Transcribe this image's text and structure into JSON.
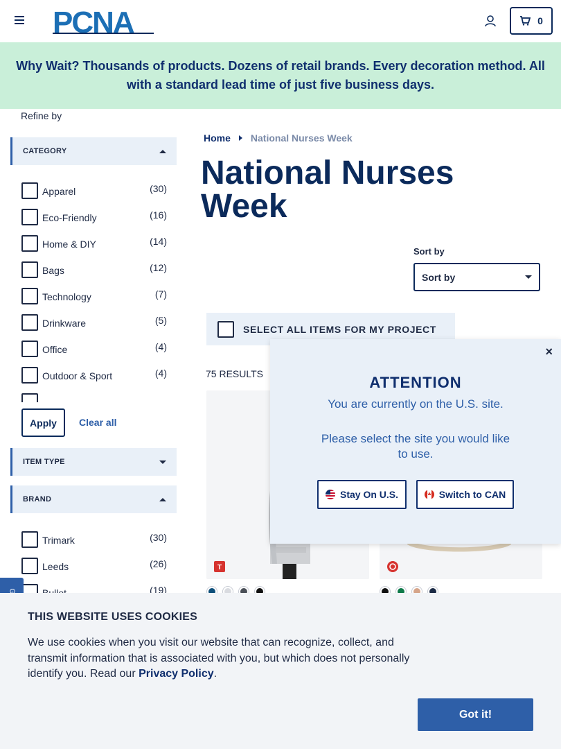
{
  "header": {
    "logo_text": "PCNA",
    "cart_count": "0"
  },
  "banner": {
    "text": "Why Wait? Thousands of products. Dozens of retail brands. Every decoration method. All with a standard lead time of just five business days."
  },
  "sidebar": {
    "refine_label": "Refine by",
    "category": {
      "title": "CATEGORY",
      "items": [
        {
          "label": "Apparel",
          "count": "(30)"
        },
        {
          "label": "Eco-Friendly",
          "count": "(16)"
        },
        {
          "label": "Home & DIY",
          "count": "(14)"
        },
        {
          "label": "Bags",
          "count": "(12)"
        },
        {
          "label": "Technology",
          "count": "(7)"
        },
        {
          "label": "Drinkware",
          "count": "(5)"
        },
        {
          "label": "Office",
          "count": "(4)"
        },
        {
          "label": "Outdoor & Sport",
          "count": "(4)"
        }
      ]
    },
    "apply_label": "Apply",
    "clear_label": "Clear all",
    "item_type": {
      "title": "ITEM TYPE"
    },
    "brand": {
      "title": "BRAND",
      "items": [
        {
          "label": "Trimark",
          "count": "(30)"
        },
        {
          "label": "Leeds",
          "count": "(26)"
        },
        {
          "label": "Bullet",
          "count": "(19)"
        }
      ]
    }
  },
  "main": {
    "breadcrumb": {
      "home": "Home",
      "current": "National Nurses Week"
    },
    "title": "National Nurses Week",
    "sort_label": "Sort by",
    "sort_value": "Sort by",
    "select_all_label": "SELECT ALL ITEMS FOR MY PROJECT",
    "results": "75 RESULTS",
    "product1_swatches": [
      "#0e4f7a",
      "#d9dbe0",
      "#4a4f57",
      "#111111"
    ],
    "product2_swatches": [
      "#111111",
      "#0f7a4a",
      "#d6a58a",
      "#1b2a45"
    ]
  },
  "modal": {
    "close": "×",
    "title": "ATTENTION",
    "text1": "You are currently on the U.S. site.",
    "text2": "Please select the site you would like to use.",
    "stay_label": "Stay On U.S.",
    "switch_label": "Switch to CAN"
  },
  "feedback": {
    "label": "Gi"
  },
  "cookie": {
    "title": "THIS WEBSITE USES COOKIES",
    "text": "We use cookies when you visit our website that can recognize, collect, and transmit information that is associated with you, but which does not personally identify you. Read our ",
    "link": "Privacy Policy",
    "end": ".",
    "button": "Got it!"
  },
  "colors": {
    "brand_navy": "#0b2a5b",
    "accent_blue": "#2e5fa8",
    "banner_green": "#c9efd9"
  }
}
